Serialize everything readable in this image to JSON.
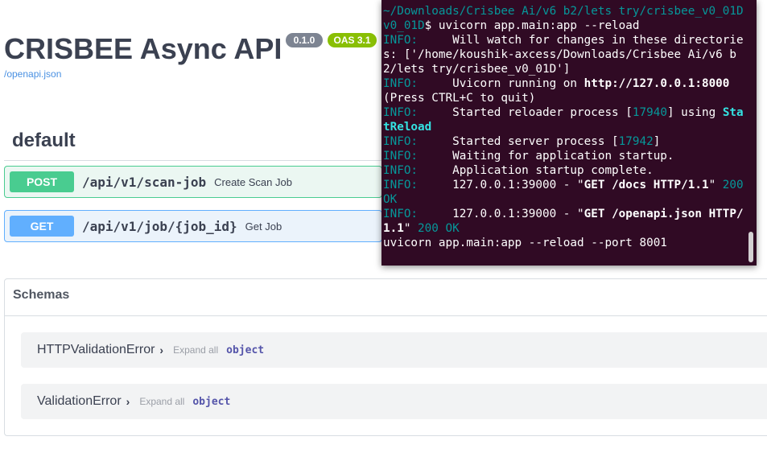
{
  "app": {
    "title": "CRISBEE Async API",
    "version_badge": "0.1.0",
    "oas_badge": "OAS 3.1",
    "spec_link": "/openapi.json"
  },
  "tag": {
    "name": "default"
  },
  "operations": [
    {
      "method": "POST",
      "path": "/api/v1/scan-job",
      "summary": "Create Scan Job"
    },
    {
      "method": "GET",
      "path": "/api/v1/job/{job_id}",
      "summary": "Get Job"
    }
  ],
  "schemas": {
    "title": "Schemas",
    "models": [
      {
        "name": "HTTPValidationError",
        "expand_label": "Expand all",
        "type": "object"
      },
      {
        "name": "ValidationError",
        "expand_label": "Expand all",
        "type": "object"
      }
    ]
  },
  "terminal": {
    "line0": "~/Downloads/Crisbee Ai/v6 b2/lets try/crisbee_v0_01D",
    "prompt_dir": "v0_01D",
    "prompt_cmd": "$ uvicorn app.main:app --reload",
    "level": "INFO:",
    "msg_watch": "     Will watch for changes in these directories: ['/home/koushik-axcess/Downloads/Crisbee Ai/v6 b2/lets try/crisbee_v0_01D']",
    "msg_running_pre": "     Uvicorn running on ",
    "msg_running_url": "http://127.0.0.1:8000",
    "msg_running_post": " (Press CTRL+C to quit)",
    "msg_reloader_pre": "     Started reloader process [",
    "reloader_pid": "17940",
    "msg_reloader_mid": "] using ",
    "reloader_name": "StatReload",
    "msg_server_pre": "     Started server process [",
    "server_pid": "17942",
    "msg_server_post": "]",
    "msg_waiting": "     Waiting for application startup.",
    "msg_complete": "     Application startup complete.",
    "msg_req1_pre": "     127.0.0.1:39000 - \"",
    "req1": "GET /docs HTTP/1.1",
    "msg_req_quote": "\"",
    "status1": " 200 OK",
    "msg_req2_pre": "     127.0.0.1:39000 - \"",
    "req2": "GET /openapi.json HTTP/1.1",
    "status2": " 200 OK",
    "last_cmd": "uvicorn app.main:app --reload --port 8001"
  }
}
